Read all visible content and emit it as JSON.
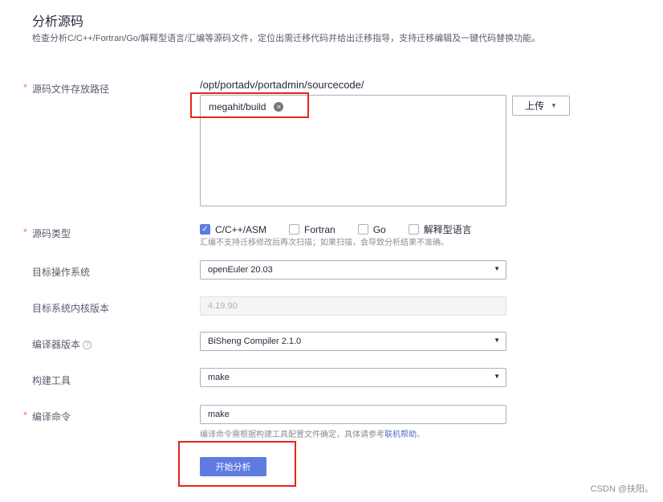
{
  "header": {
    "title": "分析源码",
    "description": "检查分析C/C++/Fortran/Go/解释型语言/汇编等源码文件，定位出需迁移代码并给出迁移指导，支持迁移编辑及一键代码替换功能。"
  },
  "form": {
    "required_mark": "*",
    "source_path": {
      "label": "源码文件存放路径",
      "base_path": "/opt/portadv/portadmin/sourcecode/",
      "tag": "megahit/build",
      "tag_close": "×",
      "upload_label": "上传",
      "upload_caret": "▼"
    },
    "source_type": {
      "label": "源码类型",
      "check_mark": "✓",
      "options": [
        {
          "label": "C/C++/ASM",
          "checked": true
        },
        {
          "label": "Fortran",
          "checked": false
        },
        {
          "label": "Go",
          "checked": false
        },
        {
          "label": "解释型语言",
          "checked": false
        }
      ],
      "hint": "汇编不支持迁移修改后再次扫描；如果扫描，会导致分析结果不准确。"
    },
    "target_os": {
      "label": "目标操作系统",
      "value": "openEuler 20.03",
      "caret": "▼"
    },
    "kernel_version": {
      "label": "目标系统内核版本",
      "value": "4.19.90"
    },
    "compiler": {
      "label": "编译器版本",
      "help": "?",
      "value": "BiSheng Compiler 2.1.0",
      "caret": "▼"
    },
    "build_tool": {
      "label": "构建工具",
      "value": "make",
      "caret": "▼"
    },
    "compile_cmd": {
      "label": "编译命令",
      "value": "make",
      "hint": "编译命令需根据构建工具配置文件确定，具体请参考",
      "hint_link": "联机帮助",
      "hint_end": "。"
    },
    "start_button": "开始分析"
  },
  "watermark": "CSDN @扶阳。",
  "colors": {
    "primary": "#5e7ce0",
    "required": "#f66f6a",
    "highlight_box": "#e4241c",
    "link": "#526ecc"
  }
}
